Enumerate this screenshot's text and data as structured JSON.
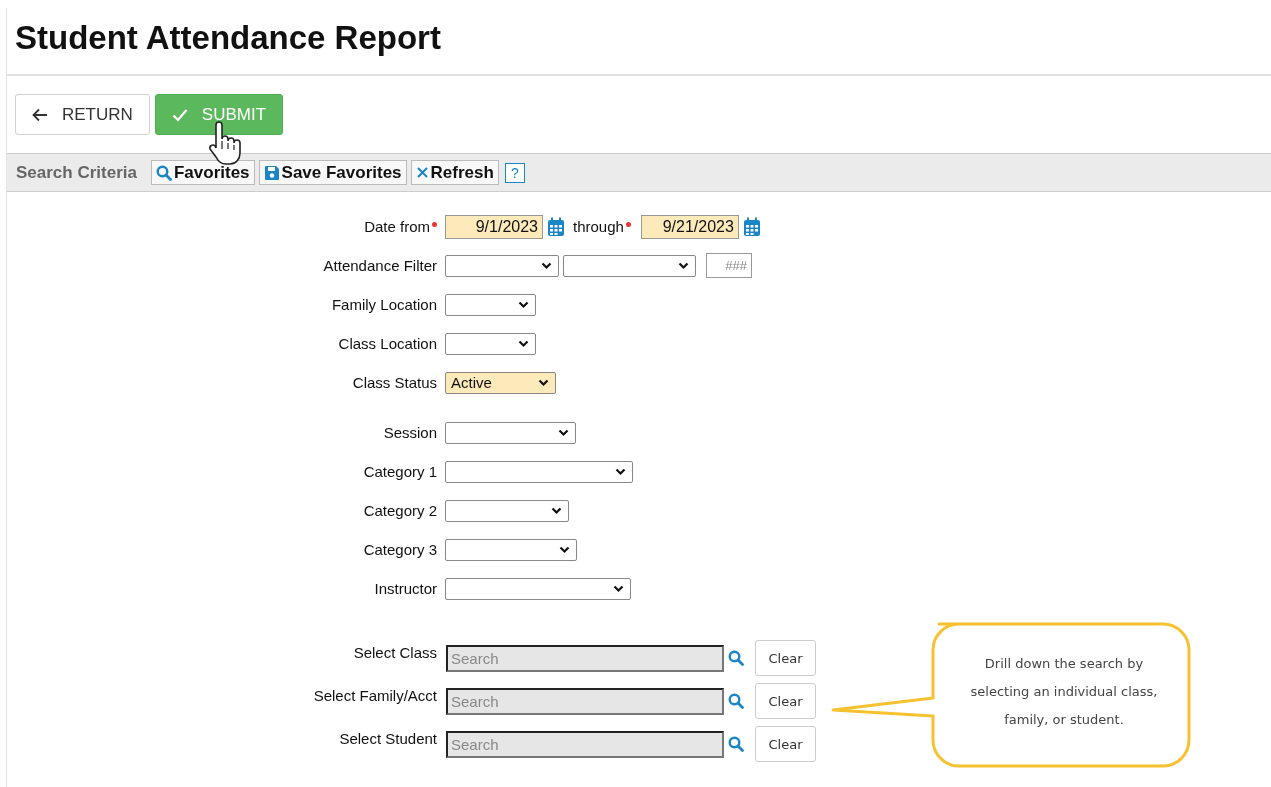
{
  "title": "Student Attendance Report",
  "actions": [
    {
      "kind": "return",
      "label": "RETURN"
    },
    {
      "kind": "submit",
      "label": "SUBMIT"
    }
  ],
  "criteria_bar": {
    "label": "Search Criteria",
    "buttons": [
      {
        "kind": "search",
        "label": "Favorites"
      },
      {
        "kind": "save",
        "label": "Save Favorites"
      },
      {
        "kind": "clear",
        "label": "Refresh"
      },
      {
        "kind": "help",
        "label": "?"
      }
    ]
  },
  "groups": [
    [
      {
        "kind": "date_range",
        "label": "Date from",
        "required": true,
        "value": "9/1/2023",
        "through_label": "through",
        "through_required": true,
        "through_value": "9/21/2023"
      },
      {
        "kind": "filter",
        "label": "Attendance Filter",
        "placeholder": "###"
      },
      {
        "kind": "select",
        "label": "Family Location",
        "highlighted": false
      },
      {
        "kind": "select",
        "label": "Class Location",
        "highlighted": false
      },
      {
        "kind": "select",
        "label": "Class Status",
        "value": "Active",
        "highlighted": true
      }
    ],
    [
      {
        "kind": "select",
        "label": "Session",
        "highlighted": false
      },
      {
        "kind": "select",
        "label": "Category 1",
        "highlighted": false
      },
      {
        "kind": "select",
        "label": "Category 2",
        "highlighted": false
      },
      {
        "kind": "select",
        "label": "Category 3",
        "highlighted": false
      },
      {
        "kind": "select",
        "label": "Instructor",
        "highlighted": false
      }
    ],
    [
      {
        "kind": "lookup",
        "label": "Select Class",
        "placeholder": "Search",
        "button": "Clear"
      },
      {
        "kind": "lookup",
        "label": "Select Family/Acct",
        "placeholder": "Search",
        "button": "Clear"
      },
      {
        "kind": "lookup",
        "label": "Select Student",
        "placeholder": "Search",
        "button": "Clear"
      }
    ]
  ],
  "callout": {
    "text": "Drill down the search by selecting an individual class, family, or student."
  }
}
